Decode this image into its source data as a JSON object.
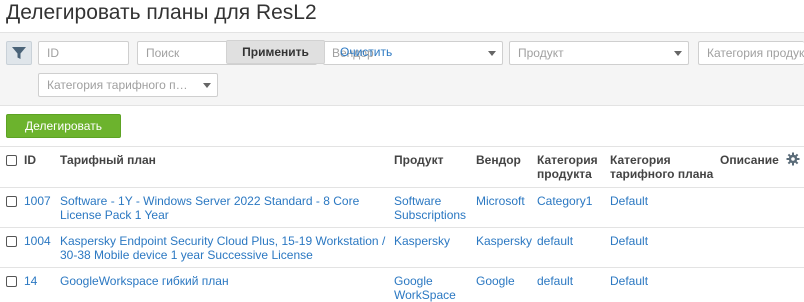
{
  "page": {
    "title": "Делегировать планы для ResL2"
  },
  "filters": {
    "id_placeholder": "ID",
    "search_placeholder": "Поиск",
    "vendor_placeholder": "Вендор",
    "product_placeholder": "Продукт",
    "product_category_placeholder": "Категория продукта",
    "plan_category_placeholder": "Категория тарифного плана",
    "apply_label": "Применить",
    "clear_label": "Очистить"
  },
  "actions": {
    "delegate_label": "Делегировать"
  },
  "table": {
    "headers": {
      "id": "ID",
      "plan": "Тарифный план",
      "product": "Продукт",
      "vendor": "Вендор",
      "product_category": "Категория продукта",
      "plan_category": "Категория тарифного плана",
      "description": "Описание"
    },
    "rows": [
      {
        "id": "1007",
        "plan": "Software - 1Y - Windows Server 2022 Standard - 8 Core License Pack 1 Year",
        "product": "Software Subscriptions",
        "vendor": "Microsoft",
        "product_category": "Category1",
        "plan_category": "Default",
        "description": ""
      },
      {
        "id": "1004",
        "plan": "Kaspersky Endpoint Security Cloud Plus, 15-19 Workstation / 30-38 Mobile device 1 year Successive License",
        "product": "Kaspersky",
        "vendor": "Kaspersky",
        "product_category": "default",
        "plan_category": "Default",
        "description": ""
      },
      {
        "id": "14",
        "plan": "GoogleWorkspace гибкий план",
        "product": "Google WorkSpace",
        "vendor": "Google",
        "product_category": "default",
        "plan_category": "Default",
        "description": ""
      }
    ]
  },
  "icons": {
    "filter": "filter-icon",
    "settings": "gear-icon"
  },
  "colors": {
    "link": "#2b78c2",
    "primary_button": "#6cb32d",
    "filter_bar_bg": "#f5f5f5"
  }
}
